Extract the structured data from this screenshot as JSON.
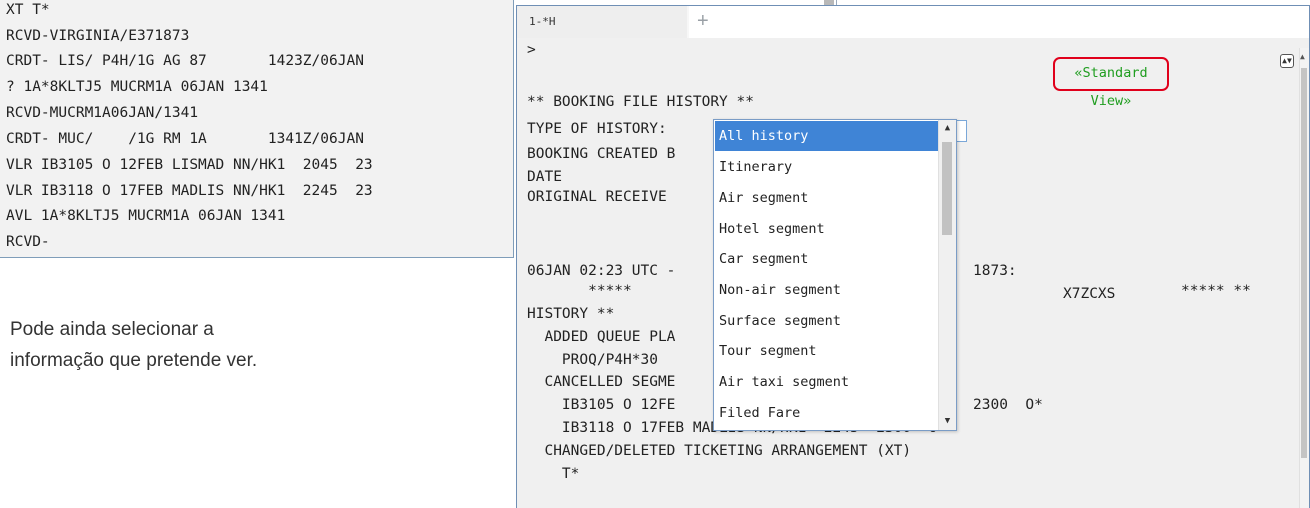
{
  "left_terminal": {
    "lines": [
      "XT T*",
      "RCVD-VIRGINIA/E371873",
      "CRDT- LIS/ P4H/1G AG 87       1423Z/06JAN",
      "? 1A*8KLTJ5 MUCRM1A 06JAN 1341",
      "RCVD-MUCRM1A06JAN/1341",
      "CRDT- MUC/    /1G RM 1A       1341Z/06JAN",
      "VLR IB3105 O 12FEB LISMAD NN/HK1  2045  23",
      "VLR IB3118 O 17FEB MADLIS NN/HK1  2245  23",
      "AVL 1A*8KLTJ5 MUCRM1A 06JAN 1341",
      "RCVD-"
    ]
  },
  "caption": {
    "line1": "Pode ainda selecionar a",
    "line2": "informação que pretende ver."
  },
  "command_window": {
    "tab_label": "1-*H",
    "add_tab_icon": "+",
    "standard_view_label": "«Standard View»",
    "prompt": ">",
    "lines": [
      "** BOOKING FILE HISTORY **",
      "TYPE OF HISTORY:",
      "BOOKING CREATED B",
      "DATE",
      "ORIGINAL RECEIVE",
      "06JAN 02:23 UTC -",
      "       *****",
      "HISTORY **",
      "  ADDED QUEUE PLA",
      "    PROQ/P4H*30",
      "  CANCELLED SEGME",
      "    IB3105 O 12FE",
      "    IB3118 O 17FEB MADLIS NN/HK1  2245  2300  O*",
      "  CHANGED/DELETED TICKETING ARRANGEMENT (XT)",
      "    T*"
    ],
    "right_fragments": {
      "r1873": "1873:",
      "x7zcxs": "X7ZCXS",
      "stars": "***** **",
      "t2300a": "2300  O*"
    }
  },
  "history_dropdown": {
    "selected": "All history",
    "options": [
      "All history",
      "Itinerary",
      "Air segment",
      "Hotel segment",
      "Car segment",
      "Non-air segment",
      "Surface segment",
      "Tour segment",
      "Air taxi segment",
      "Filed Fare"
    ]
  },
  "colors": {
    "selected_option": "#3f84d6",
    "standard_view_text": "#1f9d1f",
    "highlight_box": "#e0001b",
    "window_border": "#6f8fb5"
  }
}
